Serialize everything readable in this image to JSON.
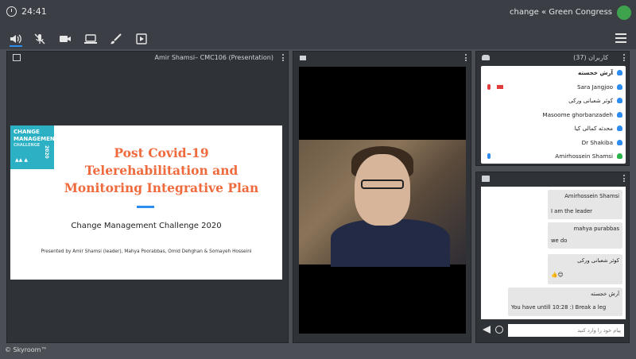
{
  "topbar": {
    "timer": "24:41",
    "title": "change « Green Congress"
  },
  "toolbar": {
    "icons": [
      "speaker-icon",
      "mic-muted-icon",
      "camera-icon",
      "screen-share-icon",
      "brush-icon",
      "play-icon",
      "menu-icon"
    ]
  },
  "presentation": {
    "header": "Amir Shamsi– CMC106 (Presentation)",
    "slide": {
      "badge_line1": "CHANGE",
      "badge_line2": "MANAGEMENT",
      "badge_line3": "CHALLENGE",
      "badge_year": "2020",
      "title_line1": "Post Covid-19",
      "title_line2": "Telerehabilitation and",
      "title_line3": "Monitoring Integrative Plan",
      "subtitle": "Change Management Challenge 2020",
      "credit": "Presented by Amir Shamsi (leader), Mahya Poorabbas, Omid Dehghan & Somayeh Hosseini"
    }
  },
  "users": {
    "header": "کاربران (37)",
    "list": [
      {
        "name": "آرش خجسته",
        "bold": true
      },
      {
        "name": "Sara Jangjoo"
      },
      {
        "name": "کوثر شعبانی ورکی"
      },
      {
        "name": "Masoome ghorbanzadeh"
      },
      {
        "name": "محدثه کمالی کیا"
      },
      {
        "name": "Dr Shakiba"
      },
      {
        "name": "Amirhossein Shamsi"
      }
    ]
  },
  "chat": {
    "messages": [
      {
        "sender": "Amirhossein Shamsi",
        "text": "I am the leader"
      },
      {
        "sender": "mahya purabbas",
        "text": "we do"
      },
      {
        "sender": "کوثر شعبانی ورکی",
        "text": "👍😊"
      },
      {
        "sender": "آرش خجسته",
        "text": "You have untill 10:28 :) Break a leg"
      }
    ],
    "input_placeholder": "پیام خود را وارد کنید"
  },
  "footer": "© Skyroom™",
  "colors": {
    "accent": "#2d8cf0",
    "slide_title": "#ef6a3d",
    "badge": "#2bb0c4",
    "online": "#2bb34b",
    "alert": "#e23b3b"
  }
}
